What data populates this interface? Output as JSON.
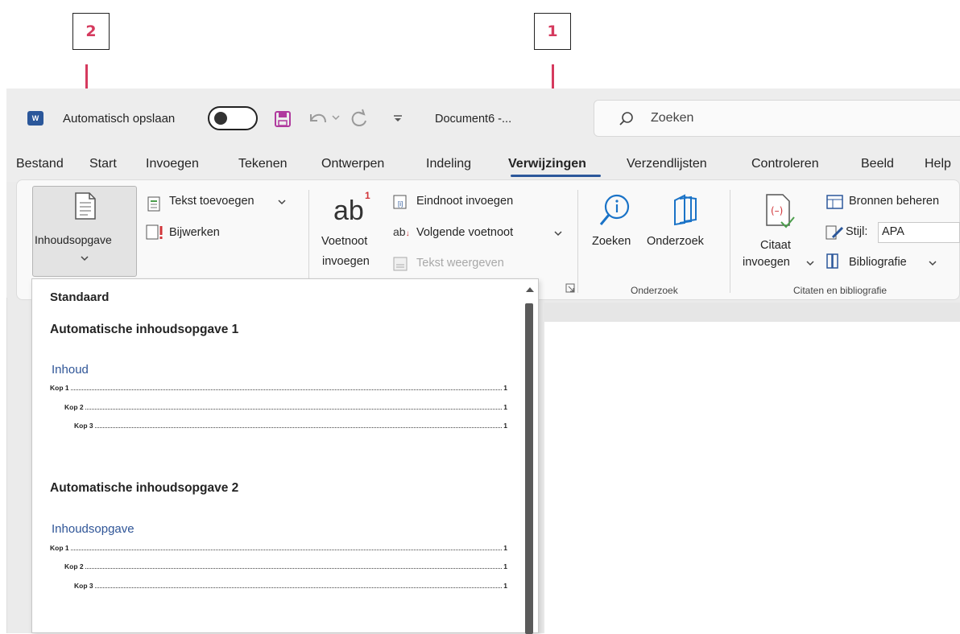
{
  "callouts": [
    {
      "label": "1"
    },
    {
      "label": "2"
    }
  ],
  "titlebar": {
    "app_icon": "word-icon",
    "autosave_label": "Automatisch opslaan",
    "doc_name": "Document6  -...",
    "search_placeholder": "Zoeken"
  },
  "tabs": [
    "Bestand",
    "Start",
    "Invoegen",
    "Tekenen",
    "Ontwerpen",
    "Indeling",
    "Verwijzingen",
    "Verzendlijsten",
    "Controleren",
    "Beeld",
    "Help"
  ],
  "active_tab": "Verwijzingen",
  "ribbon": {
    "toc": {
      "label": "Inhoudsopgave",
      "add_text": "Tekst toevoegen",
      "update": "Bijwerken"
    },
    "footnotes": {
      "insert_footnote_1": "Voetnoot",
      "insert_footnote_2": "invoegen",
      "endnote": "Eindnoot invoegen",
      "next_footnote": "Volgende voetnoot",
      "show_notes": "Tekst weergeven"
    },
    "research": {
      "search": "Zoeken",
      "researcher": "Onderzoek",
      "group": "Onderzoek"
    },
    "citations": {
      "insert_citation_1": "Citaat",
      "insert_citation_2": "invoegen",
      "manage_sources": "Bronnen beheren",
      "style_label": "Stijl:",
      "style_value": "APA",
      "bibliography": "Bibliografie",
      "group": "Citaten en bibliografie"
    }
  },
  "dropdown": {
    "heading": "Standaard",
    "items": [
      {
        "title": "Automatische inhoudsopgave 1",
        "toc_heading": "Inhoud",
        "lines": [
          {
            "text": "Kop 1",
            "page": "1"
          },
          {
            "text": "Kop 2",
            "page": "1"
          },
          {
            "text": "Kop 3",
            "page": "1"
          }
        ]
      },
      {
        "title": "Automatische inhoudsopgave 2",
        "toc_heading": "Inhoudsopgave",
        "lines": [
          {
            "text": "Kop 1",
            "page": "1"
          },
          {
            "text": "Kop 2",
            "page": "1"
          },
          {
            "text": "Kop 3",
            "page": "1"
          }
        ]
      }
    ]
  },
  "colors": {
    "accent": "#d53a5e",
    "link_blue": "#2f5597",
    "active_tab_underline": "#2b579a"
  }
}
